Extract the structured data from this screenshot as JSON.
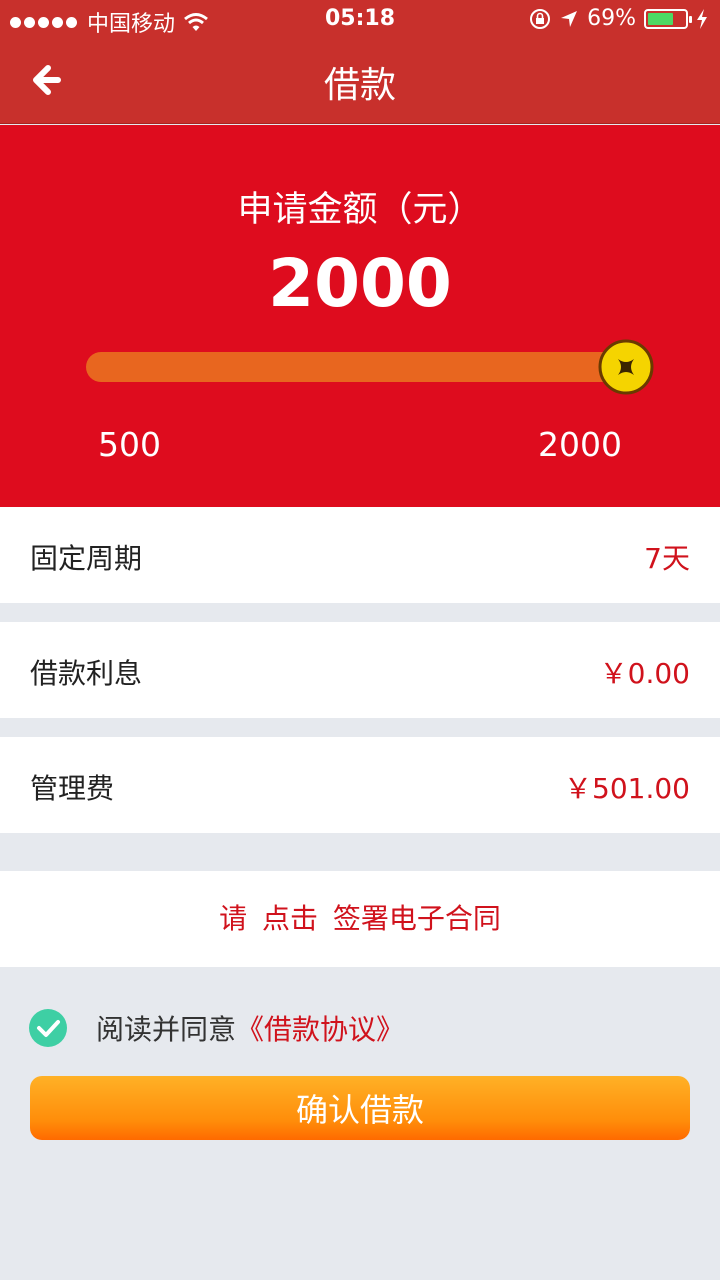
{
  "status_bar": {
    "carrier": "中国移动",
    "time": "05:18",
    "battery": "69%",
    "battery_level": 0.69
  },
  "nav": {
    "title": "借款",
    "back_icon": "arrow-left-icon"
  },
  "loan": {
    "amount_label": "申请金额（元）",
    "amount_value": "2000",
    "min_label": "500",
    "max_label": "2000",
    "slider_value": 2000,
    "slider_min": 500,
    "slider_max": 2000
  },
  "details": [
    {
      "label": "固定周期",
      "value": "7天"
    },
    {
      "label": "借款利息",
      "value": "￥0.00"
    },
    {
      "label": "管理费",
      "value": "￥501.00"
    }
  ],
  "sign": {
    "text": "请 点击 签署电子合同"
  },
  "agreement": {
    "checked": true,
    "prefix": "阅读并同意",
    "link": "《借款协议》"
  },
  "confirm_button": {
    "label": "确认借款"
  },
  "colors": {
    "header": "#c8302c",
    "hero": "#de0c1e",
    "accent_red": "#d0121c",
    "button_orange": "#ff8d0a",
    "check_green": "#3ecfa4"
  }
}
